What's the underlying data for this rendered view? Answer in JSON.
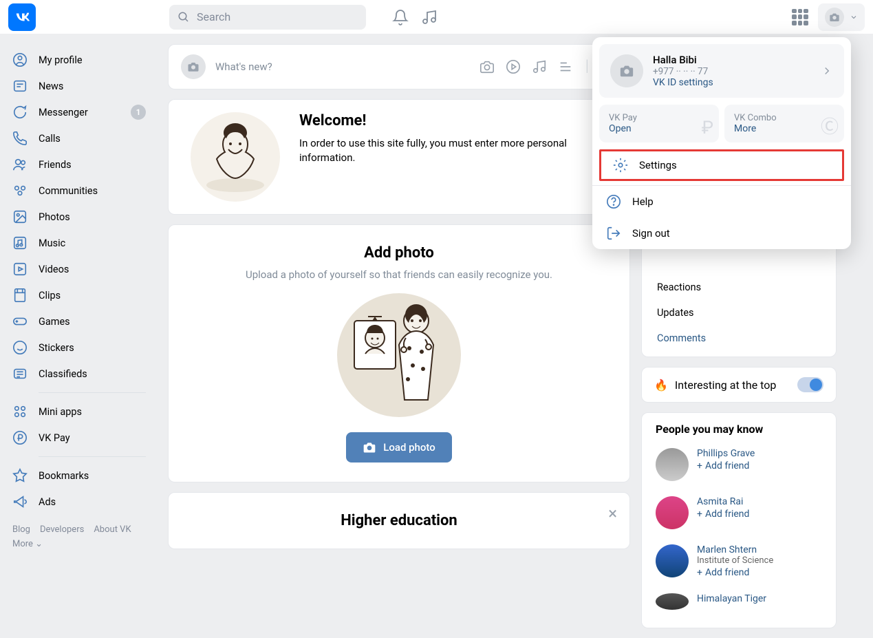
{
  "header": {
    "search_placeholder": "Search"
  },
  "sidebar": {
    "items": [
      {
        "label": "My profile"
      },
      {
        "label": "News"
      },
      {
        "label": "Messenger",
        "badge": "1"
      },
      {
        "label": "Calls"
      },
      {
        "label": "Friends"
      },
      {
        "label": "Communities"
      },
      {
        "label": "Photos"
      },
      {
        "label": "Music"
      },
      {
        "label": "Videos"
      },
      {
        "label": "Clips"
      },
      {
        "label": "Games"
      },
      {
        "label": "Stickers"
      },
      {
        "label": "Classifieds"
      }
    ],
    "items2": [
      {
        "label": "Mini apps"
      },
      {
        "label": "VK Pay"
      }
    ],
    "items3": [
      {
        "label": "Bookmarks"
      },
      {
        "label": "Ads"
      }
    ],
    "footer": {
      "blog": "Blog",
      "devs": "Developers",
      "about": "About VK",
      "more": "More"
    }
  },
  "composer": {
    "placeholder": "What's new?"
  },
  "welcome": {
    "title": "Welcome!",
    "body": "In order to use this site fully, you must enter more personal information."
  },
  "addphoto": {
    "title": "Add photo",
    "body": "Upload a photo of yourself so that friends can easily recognize you.",
    "button": "Load photo"
  },
  "highered": {
    "title": "Higher education"
  },
  "filters": {
    "reactions": "Reactions",
    "updates": "Updates",
    "comments": "Comments"
  },
  "interesting": {
    "label": "Interesting at the top"
  },
  "pymk": {
    "title": "People you may know",
    "people": [
      {
        "name": "Phillips Grave",
        "sub": "",
        "add": "Add friend"
      },
      {
        "name": "Asmita Rai",
        "sub": "",
        "add": "Add friend"
      },
      {
        "name": "Marlen Shtern",
        "sub": "Institute of Science",
        "add": "Add friend"
      },
      {
        "name": "Himalayan Tiger",
        "sub": "",
        "add": ""
      }
    ]
  },
  "dropdown": {
    "name": "Halla Bibi",
    "phone": "+977 ·· ·· ·· 77",
    "id_settings": "VK ID settings",
    "pay_title": "VK Pay",
    "pay_action": "Open",
    "combo_title": "VK Combo",
    "combo_action": "More",
    "settings": "Settings",
    "help": "Help",
    "signout": "Sign out"
  }
}
